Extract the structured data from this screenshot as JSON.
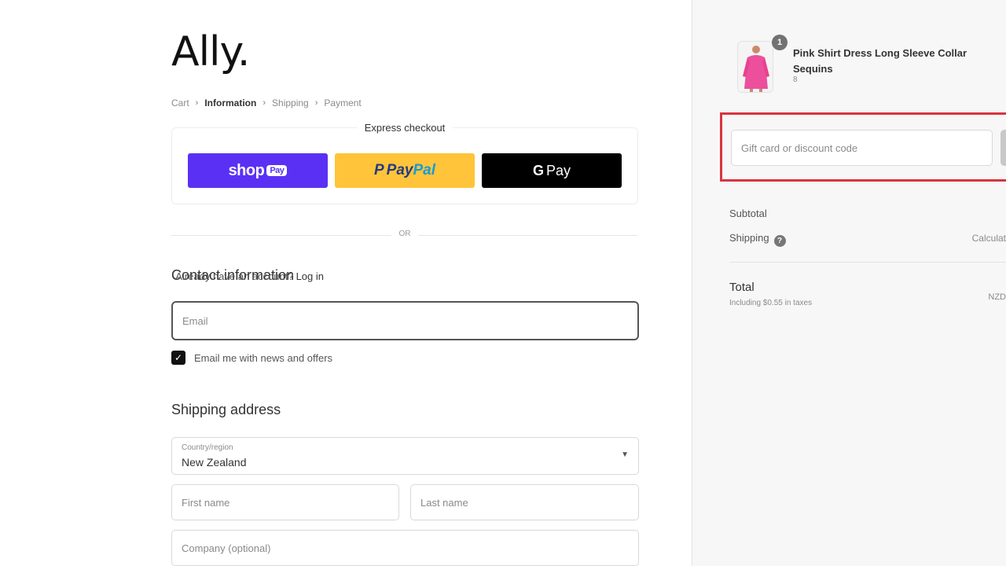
{
  "brand": {
    "logo_text": "Ally."
  },
  "breadcrumb": {
    "items": [
      "Cart",
      "Information",
      "Shipping",
      "Payment"
    ],
    "separator": "›"
  },
  "express_checkout": {
    "title": "Express checkout",
    "shop_pay": {
      "label": "shop",
      "pill": "Pay",
      "color": "#5a31f4"
    },
    "paypal": {
      "mark": "P",
      "label_a": "Pay",
      "label_b": "Pal",
      "color": "#ffc439"
    },
    "gpay": {
      "mark": "G",
      "label": "Pay",
      "color": "#000000"
    }
  },
  "divider_text": "OR",
  "contact": {
    "title": "Contact information",
    "account_prompt": "Already have an account?",
    "login_link": "Log in",
    "email_placeholder": "Email",
    "newsletter_label": "Email me with news and offers",
    "newsletter_checked": true
  },
  "shipping": {
    "title": "Shipping address",
    "country_label": "Country/region",
    "country_value": "New Zealand",
    "first_name_placeholder": "First name",
    "last_name_placeholder": "Last name",
    "company_placeholder": "Company (optional)"
  },
  "summary": {
    "product": {
      "name": "Pink Shirt Dress Long Sleeve Collar Sequins",
      "variant": "8",
      "quantity": "1"
    },
    "discount_placeholder": "Gift card or discount code",
    "highlight_color": "#d9343f",
    "subtotal_label": "Subtotal",
    "shipping_label": "Shipping",
    "shipping_value": "Calculat",
    "total_label": "Total",
    "tax_note": "Including $0.55 in taxes",
    "total_currency": "NZD"
  }
}
